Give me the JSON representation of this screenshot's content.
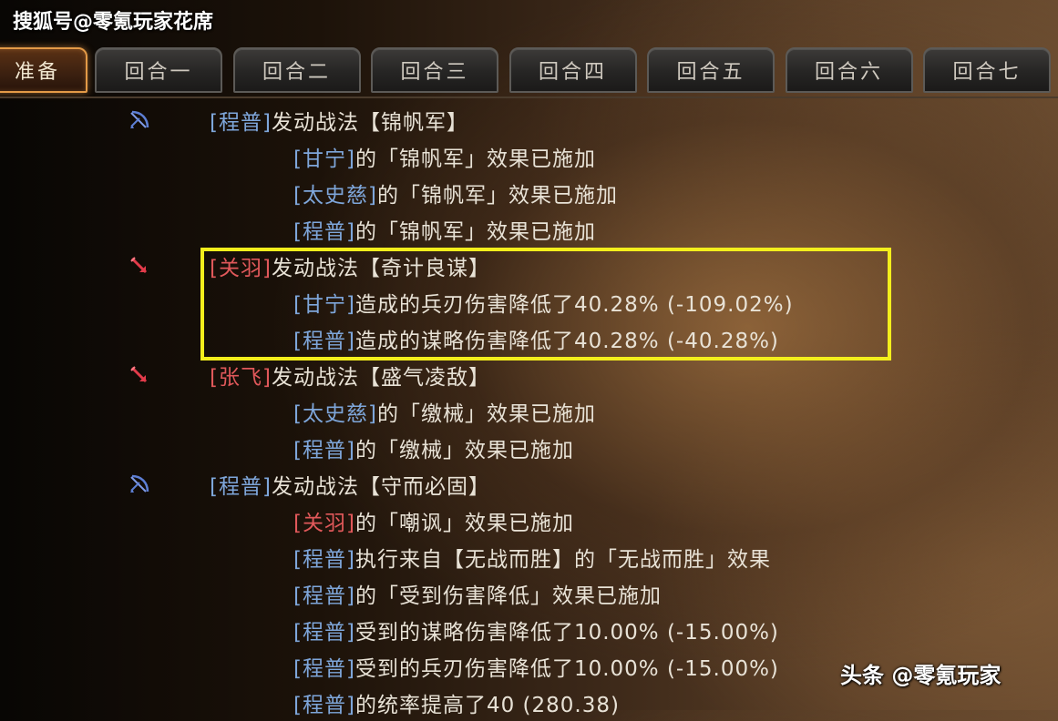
{
  "watermark_top": "搜狐号@零氪玩家花席",
  "watermark_bottom": "头条 @零氪玩家",
  "tabs": [
    "准备",
    "回合一",
    "回合二",
    "回合三",
    "回合四",
    "回合五",
    "回合六",
    "回合七"
  ],
  "active_tab": "准备",
  "colors": {
    "highlight_box": "#f3ee1c",
    "blue_name": "#7ea6da",
    "red_name": "#e0585a",
    "active_tab_border": "#e39a47"
  },
  "log": [
    {
      "icon": "bow-icon",
      "side": "blue",
      "indent": 0,
      "name": "[程普]",
      "text": " 发动战法【锦帆军】"
    },
    {
      "side": "blue",
      "indent": 1,
      "name": "[甘宁]",
      "text": "的「锦帆军」效果已施加"
    },
    {
      "side": "blue",
      "indent": 1,
      "name": "[太史慈]",
      "text": "的「锦帆军」效果已施加"
    },
    {
      "side": "blue",
      "indent": 1,
      "name": "[程普]",
      "text": "的「锦帆军」效果已施加"
    },
    {
      "icon": "red-arrow-icon",
      "side": "red",
      "indent": 0,
      "name": "[关羽]",
      "text": " 发动战法【奇计良谋】"
    },
    {
      "side": "blue",
      "indent": 1,
      "name": "[甘宁]",
      "text": "造成的兵刃伤害降低了40.28% (-109.02%)"
    },
    {
      "side": "blue",
      "indent": 1,
      "name": "[程普]",
      "text": "造成的谋略伤害降低了40.28% (-40.28%)"
    },
    {
      "icon": "red-arrow-icon",
      "side": "red",
      "indent": 0,
      "name": "[张飞]",
      "text": " 发动战法【盛气凌敌】"
    },
    {
      "side": "blue",
      "indent": 1,
      "name": "[太史慈]",
      "text": "的「缴械」效果已施加"
    },
    {
      "side": "blue",
      "indent": 1,
      "name": "[程普]",
      "text": "的「缴械」效果已施加"
    },
    {
      "icon": "bow-icon",
      "side": "blue",
      "indent": 0,
      "name": "[程普]",
      "text": " 发动战法【守而必固】"
    },
    {
      "side": "red",
      "indent": 1,
      "name": "[关羽]",
      "text": "的「嘲讽」效果已施加"
    },
    {
      "side": "blue",
      "indent": 1,
      "name": "[程普]",
      "text": "执行来自【无战而胜】的「无战而胜」效果"
    },
    {
      "side": "blue",
      "indent": 1,
      "name": "[程普]",
      "text": "的「受到伤害降低」效果已施加"
    },
    {
      "side": "blue",
      "indent": 1,
      "name": "[程普]",
      "text": "受到的谋略伤害降低了10.00% (-15.00%)"
    },
    {
      "side": "blue",
      "indent": 1,
      "name": "[程普]",
      "text": "受到的兵刃伤害降低了10.00% (-15.00%)"
    },
    {
      "side": "blue",
      "indent": 1,
      "name": "[程普]",
      "text": "的统率提高了40 (280.38)"
    }
  ]
}
